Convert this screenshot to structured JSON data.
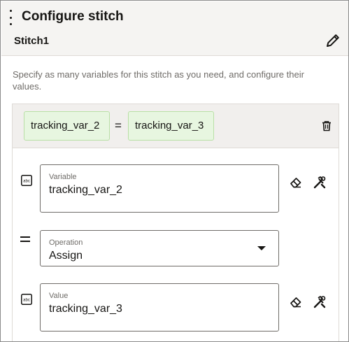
{
  "header": {
    "title": "Configure stitch",
    "stitch_name": "Stitch1"
  },
  "description": "Specify as many variables for this stitch as you need, and configure their values.",
  "summary": {
    "left_chip": "tracking_var_2",
    "equals": "=",
    "right_chip": "tracking_var_3"
  },
  "variable_field": {
    "label": "Variable",
    "value": "tracking_var_2"
  },
  "operation_field": {
    "label": "Operation",
    "value": "Assign"
  },
  "value_field": {
    "label": "Value",
    "value": "tracking_var_3"
  },
  "icons": {
    "menu": "kebab-icon",
    "edit": "pencil-icon",
    "delete": "trash-icon",
    "text_type": "abc-type-icon",
    "clear": "eraser-icon",
    "mapper": "tools-icon",
    "operator": "equals-icon"
  }
}
